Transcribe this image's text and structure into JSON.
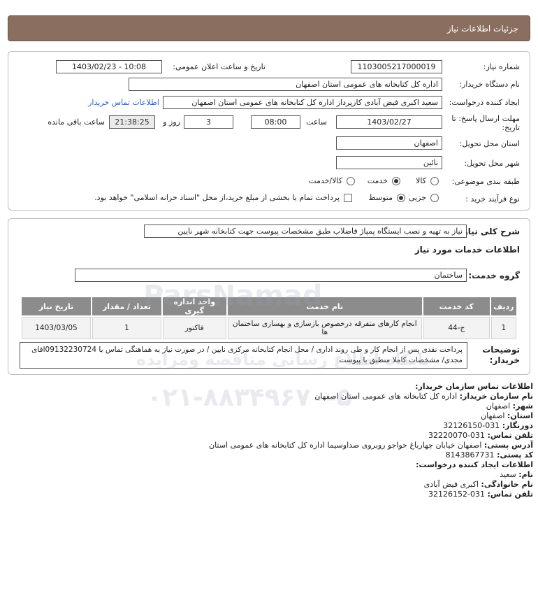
{
  "header": {
    "title": "جزئیات اطلاعات نیاز"
  },
  "details": {
    "need_number_label": "شماره نیاز:",
    "need_number": "1103005217000019",
    "announce_label": "تاریخ و ساعت اعلان عمومی:",
    "announce_value": "1403/02/23 - 10:08",
    "buyer_label": "نام دستگاه خریدار:",
    "buyer_value": "اداره کل کتابخانه های عمومی استان اصفهان",
    "creator_label": "ایجاد کننده درخواست:",
    "creator_value": "سعید اکبری فیض آبادی کارپرداز اداره کل کتابخانه های عمومی استان اصفهان",
    "contact_link": "اطلاعات تماس خریدار",
    "deadline_label": "مهلت ارسال پاسخ: تا تاریخ:",
    "deadline_date": "1403/02/27",
    "time_label": "ساعت",
    "deadline_time": "08:00",
    "days_value": "3",
    "days_label": "روز و",
    "remaining_value": "21:38:25",
    "remaining_label": "ساعت باقی مانده",
    "province_label": "استان محل تحویل:",
    "province_value": "اصفهان",
    "city_label": "شهر محل تحویل:",
    "city_value": "نائین",
    "category_label": "طبقه بندی موضوعی:",
    "category_options": [
      "کالا",
      "خدمت",
      "کالا/خدمت"
    ],
    "category_selected": "خدمت",
    "process_label": "نوع فرآیند خرید :",
    "process_options": [
      "جزیی",
      "متوسط"
    ],
    "process_selected": "متوسط",
    "treasury_text": "پرداخت تمام یا بخشی از مبلغ خرید،از محل \"اسناد خزانه اسلامی\" خواهد بود."
  },
  "summary": {
    "label": "شرح کلی نیاز:",
    "value": "نیاز به تهیه و نصب ایستگاه پمپاژ فاضلاب طبق مشخصات پیوست جهت کتابخانه شهر نایین",
    "services_title": "اطلاعات خدمات مورد نیاز",
    "group_label": "گروه خدمت:",
    "group_value": "ساختمان"
  },
  "table": {
    "headers": [
      "ردیف",
      "کد خدمت",
      "نام خدمت",
      "واحد اندازه گیری",
      "تعداد / مقدار",
      "تاریخ نیاز"
    ],
    "rows": [
      [
        "1",
        "ج-44",
        "انجام کارهای متفرقه درخصوص بازسازی و بهسازی ساختمان ها",
        "فاکتور",
        "1",
        "1403/03/05"
      ]
    ]
  },
  "buyer_notes": {
    "label": "توضیحات خریدار:",
    "value": "پرداخت نقدی پس از انجام کار و طی روند اداری / محل انجام کتابخانه مرکزی نایین / در صورت نیاز به هماهنگی تماس با 09132230724اقای مجدی/ مشخصات کاملا منطبق با پیوست"
  },
  "contact": {
    "org_title": "اطلاعات تماس سازمان خریدار:",
    "org_name_label": "نام سازمان خریدار:",
    "org_name": "اداره کل کتابخانه های عمومی استان اصفهان",
    "city_label": "شهر:",
    "city": "اصفهان",
    "province_label": "استان:",
    "province": "اصفهان",
    "fax_label": "دورنگار:",
    "fax": "031-32126150",
    "phone_label": "تلفن تماس:",
    "phone": "031-32220070",
    "address_label": "آدرس پستی:",
    "address": "اصفهان خیابان چهارباغ خواجو روبروی صداوسیما اداره کل کتابخانه های عمومی استان",
    "postal_label": "کد پستی:",
    "postal": "8143867731",
    "creator_title": "اطلاعات ایجاد کننده درخواست:",
    "first_name_label": "نام:",
    "first_name": "سعید",
    "last_name_label": "نام خانوادگی:",
    "last_name": "اکبری فیض آبادی",
    "creator_phone_label": "تلفن تماس:",
    "creator_phone": "031-32126152"
  },
  "watermark": {
    "brand": "ParsNamad",
    "tagline": "پایگاه اطلاع رسانی مناقصه ومزایده",
    "phone": "۰۲۱-۸۸۳۴۹۶۷۰-۵"
  }
}
